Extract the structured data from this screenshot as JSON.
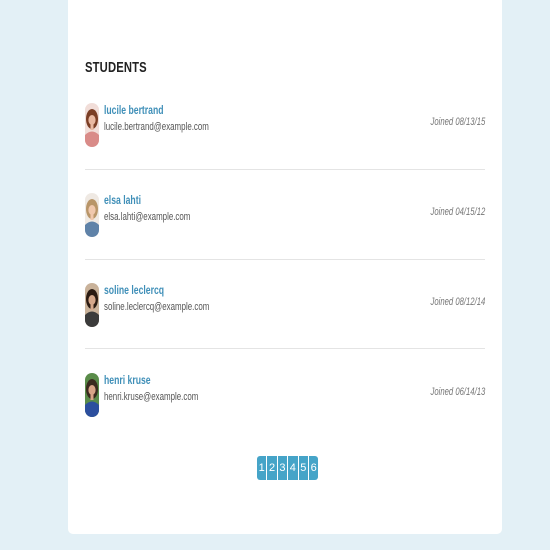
{
  "title": "STUDENTS",
  "students": [
    {
      "name": "lucile bertrand",
      "email": "lucile.bertrand@example.com",
      "joined": "Joined 08/13/15",
      "avatar": {
        "bg": "#f1ddd8",
        "hair": "#7b3e25",
        "skin": "#e9b9a2",
        "cloth": "#d98b88"
      }
    },
    {
      "name": "elsa lahti",
      "email": "elsa.lahti@example.com",
      "joined": "Joined 04/15/12",
      "avatar": {
        "bg": "#efe9e3",
        "hair": "#b89568",
        "skin": "#f0c8ad",
        "cloth": "#5f82a8"
      }
    },
    {
      "name": "soline leclercq",
      "email": "soline.leclercq@example.com",
      "joined": "Joined 08/12/14",
      "avatar": {
        "bg": "#c9b29a",
        "hair": "#2b1b12",
        "skin": "#d6a88b",
        "cloth": "#3b3b3b"
      }
    },
    {
      "name": "henri kruse",
      "email": "henri.kruse@example.com",
      "joined": "Joined 06/14/13",
      "avatar": {
        "bg": "#5a8c4a",
        "hair": "#3a2a1e",
        "skin": "#d9a487",
        "cloth": "#2c4f9e"
      }
    }
  ],
  "pagination": {
    "pages": [
      "1",
      "2",
      "3",
      "4",
      "5",
      "6"
    ],
    "color": "#45a4c8"
  }
}
